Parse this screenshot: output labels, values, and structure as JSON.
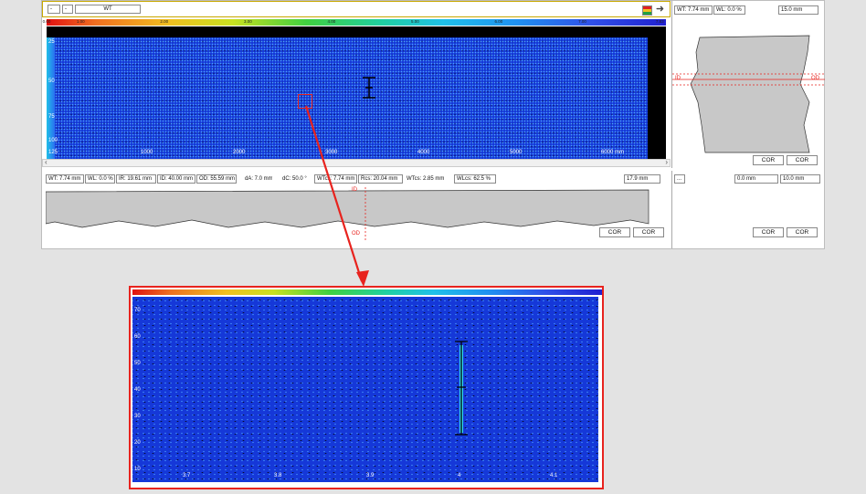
{
  "toolbar": {
    "view_select_1": "-",
    "view_select_2": "-",
    "channel_select": "WT"
  },
  "color_scale": {
    "ticks": [
      "0.00",
      "1.00",
      "2.00",
      "3.00",
      "4.00",
      "5.00",
      "6.00",
      "7.00",
      "7.83"
    ]
  },
  "cscan": {
    "y_labels": [
      "25",
      "50",
      "75",
      "100",
      "125"
    ],
    "x_labels": [
      "1000",
      "2000",
      "3000",
      "4000",
      "5000",
      "6000 mm"
    ]
  },
  "measure": {
    "wt": "WT: 7.74 mm",
    "wl": "WL: 0.0 %",
    "ir": "IR: 19.61 mm",
    "id": "ID: 40.00 mm",
    "od": "OD: 55.59 mm",
    "da": "dA: 7.0 mm",
    "dc": "dC: 50.0 °",
    "wtcs": "WTcs: 7.74 mm",
    "rcs": "Rcs: 20.04 mm",
    "dwtcs": "WTcs: 2.85 mm",
    "wlcs": "WLcs: 62.5 %",
    "scale": "17.9 mm"
  },
  "bscan": {
    "id_label": "ID",
    "od_label": "OD",
    "cor1": "COR",
    "cor2": "COR"
  },
  "right_top": {
    "wt": "WT: 7.74 mm",
    "wl": "WL: 0.0 %",
    "scale": "15.0 mm",
    "id_label": "ID",
    "od_label": "OD",
    "cor1": "COR",
    "cor2": "COR"
  },
  "right_bottom": {
    "empty": "...",
    "offset": "0.0 mm",
    "scale": "10.0 mm",
    "cor1": "COR",
    "cor2": "COR"
  },
  "zoom": {
    "y_labels": [
      "70",
      "60",
      "50",
      "40",
      "30",
      "20",
      "10"
    ],
    "x_labels": [
      "3.7",
      "3.8",
      "3.9",
      "4",
      "4.1"
    ]
  },
  "colors": {
    "accent": "#e8231e",
    "cscan_blue": "#1538d8"
  }
}
